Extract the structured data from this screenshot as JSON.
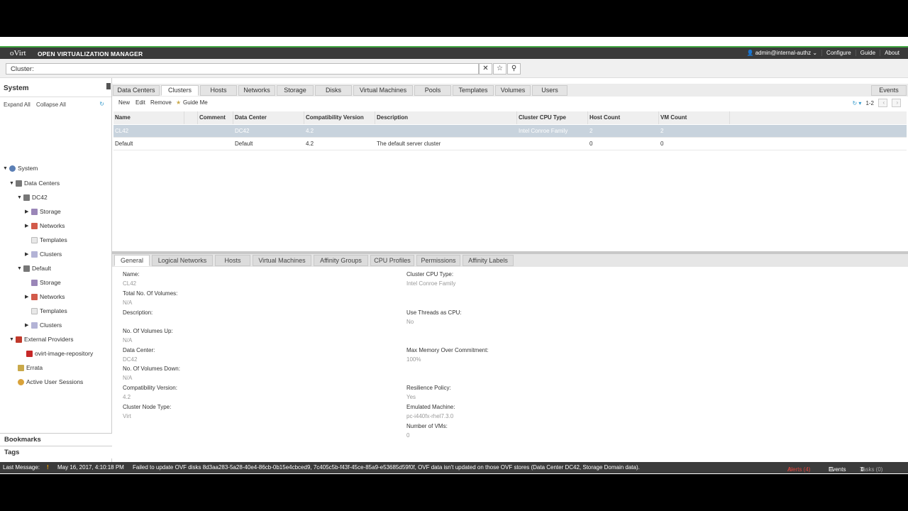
{
  "header": {
    "logo": "oVirt",
    "product": "OPEN VIRTUALIZATION MANAGER",
    "user": "admin@internal-authz",
    "links": [
      "Configure",
      "Guide",
      "About"
    ]
  },
  "search": {
    "value": "Cluster:"
  },
  "left": {
    "title": "System",
    "expand_all": "Expand All",
    "collapse_all": "Collapse All",
    "tree": {
      "system": "System",
      "data_centers": "Data Centers",
      "dc42": "DC42",
      "dc42_storage": "Storage",
      "dc42_networks": "Networks",
      "dc42_templates": "Templates",
      "dc42_clusters": "Clusters",
      "default": "Default",
      "default_storage": "Storage",
      "default_networks": "Networks",
      "default_templates": "Templates",
      "default_clusters": "Clusters",
      "external_providers": "External Providers",
      "ovirt_image_repo": "ovirt-image-repository",
      "errata": "Errata",
      "active_sessions": "Active User Sessions"
    },
    "bookmarks": "Bookmarks",
    "tags": "Tags"
  },
  "main_tabs": [
    "Data Centers",
    "Clusters",
    "Hosts",
    "Networks",
    "Storage",
    "Disks",
    "Virtual Machines",
    "Pools",
    "Templates",
    "Volumes",
    "Users"
  ],
  "events_tab": "Events",
  "toolbar": {
    "new": "New",
    "edit": "Edit",
    "remove": "Remove",
    "guide": "Guide Me",
    "range": "1-2"
  },
  "grid": {
    "columns": [
      "Name",
      "Comment",
      "Data Center",
      "Compatibility Version",
      "Description",
      "Cluster CPU Type",
      "Host Count",
      "VM Count"
    ],
    "rows": [
      [
        "CL42",
        "",
        "DC42",
        "4.2",
        "",
        "Intel Conroe Family",
        "2",
        "2"
      ],
      [
        "Default",
        "",
        "Default",
        "4.2",
        "The default server cluster",
        "",
        "0",
        "0"
      ]
    ]
  },
  "sub_tabs": [
    "General",
    "Logical Networks",
    "Hosts",
    "Virtual Machines",
    "Affinity Groups",
    "CPU Profiles",
    "Permissions",
    "Affinity Labels"
  ],
  "details": {
    "left": [
      {
        "label": "Name:",
        "value": "CL42"
      },
      {
        "label": "Total No. Of Volumes:",
        "value": "N/A"
      },
      {
        "label": "Description:",
        "value": ""
      },
      {
        "label": "No. Of Volumes Up:",
        "value": "N/A"
      },
      {
        "label": "Data Center:",
        "value": "DC42"
      },
      {
        "label": "No. Of Volumes Down:",
        "value": "N/A"
      },
      {
        "label": "Compatibility Version:",
        "value": "4.2"
      },
      {
        "label": "Cluster Node Type:",
        "value": "Virt"
      }
    ],
    "right": [
      {
        "label": "Cluster CPU Type:",
        "value": "Intel Conroe Family"
      },
      {
        "label": "Use Threads as CPU:",
        "value": "No"
      },
      {
        "label": "Max Memory Over Commitment:",
        "value": "100%"
      },
      {
        "label": "Resilience Policy:",
        "value": "Yes"
      },
      {
        "label": "Emulated Machine:",
        "value": "pc-i440fx-rhel7.3.0"
      },
      {
        "label": "Number of VMs:",
        "value": "0"
      }
    ]
  },
  "status": {
    "label": "Last Message:",
    "time": "May 16, 2017, 4:10:18 PM",
    "message": "Failed to update OVF disks 8d3aa283-5a28-40e4-86cb-0b15e4cbced9, 7c405c5b-f43f-45ce-85a9-e53685d59f0f, OVF data isn't updated on those OVF stores (Data Center DC42, Storage Domain data).",
    "alerts": "Alerts (4)",
    "events": "Events",
    "tasks": "Tasks (0)"
  },
  "colors": {
    "accent_green": "#3fa33f",
    "header_bg": "#3a3a3a",
    "selected_row": "#c8d3dd",
    "alert_red": "#e0463e"
  }
}
